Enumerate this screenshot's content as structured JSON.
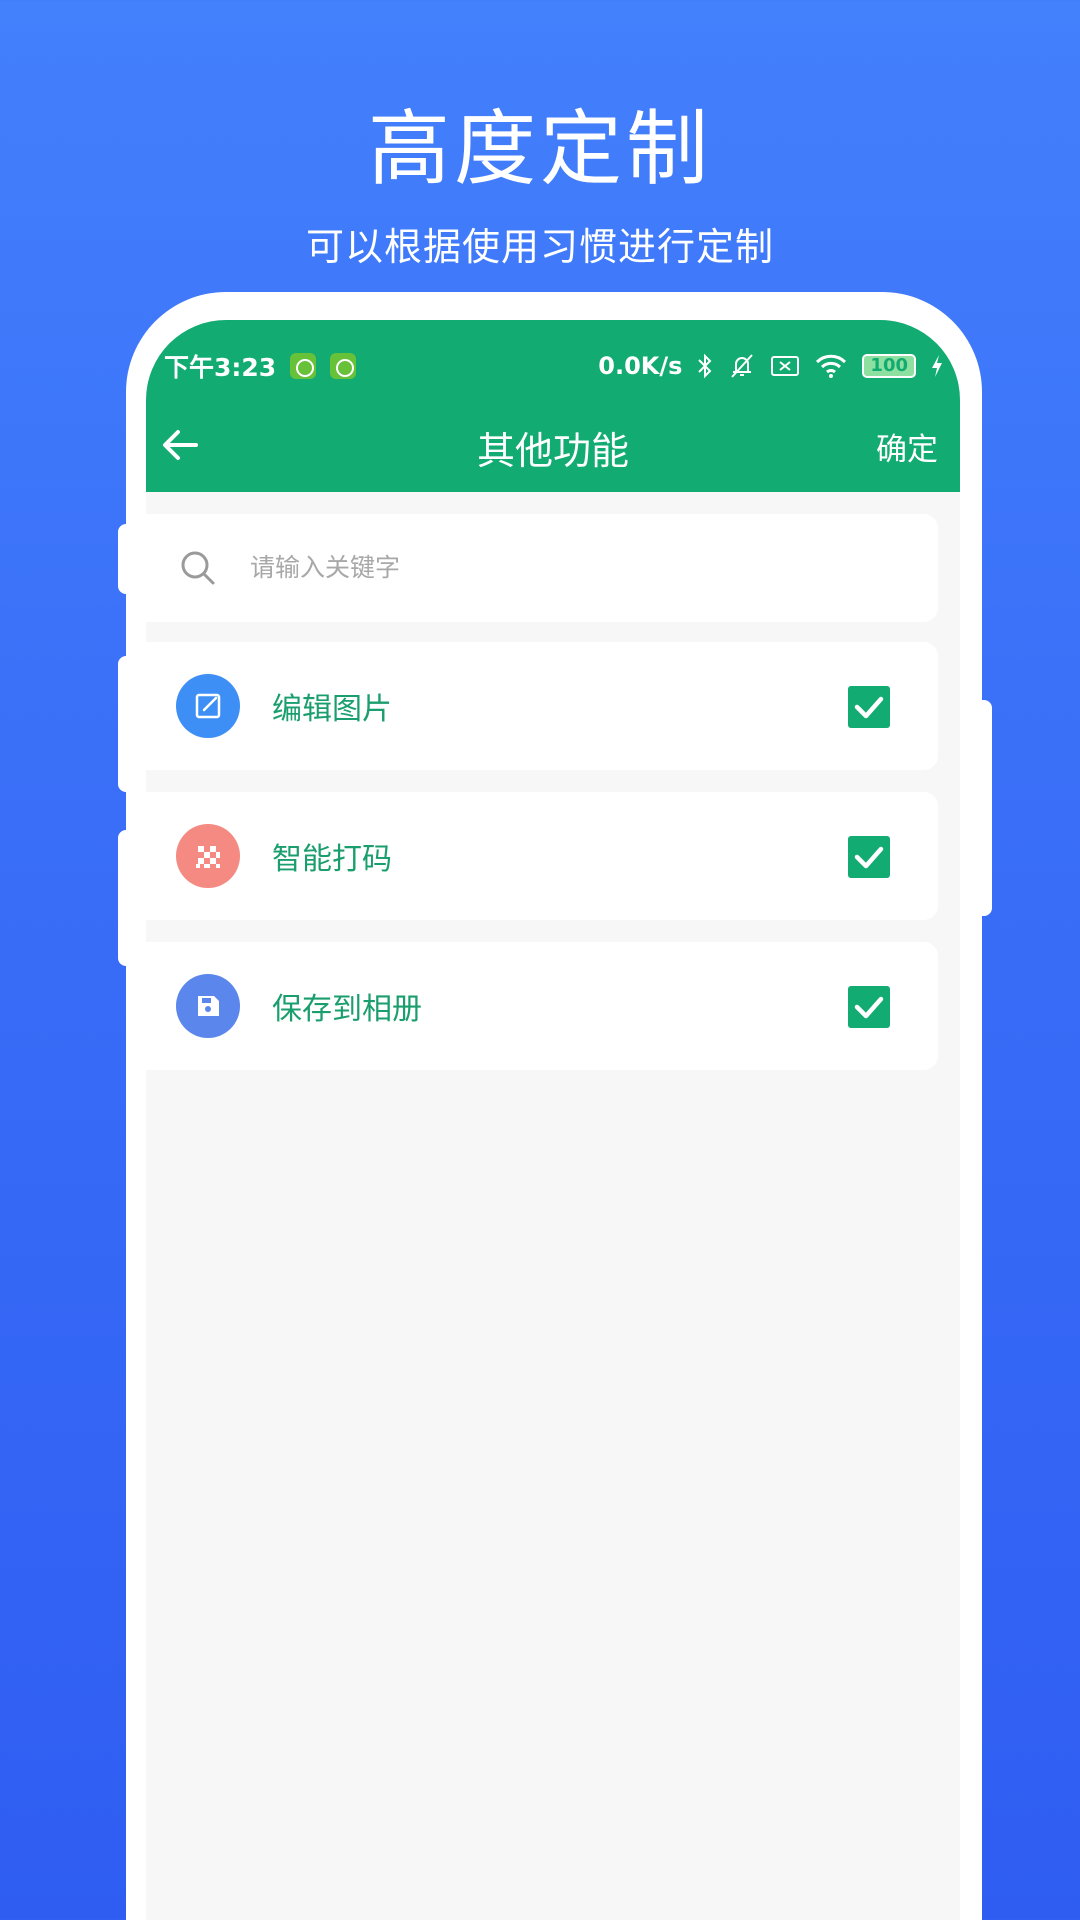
{
  "headline": "高度定制",
  "subline": "可以根据使用习惯进行定制",
  "status_bar": {
    "time": "下午3:23",
    "network_speed": "0.0K/s",
    "battery": "100",
    "icons": [
      "app-badge-icon",
      "app-badge-icon",
      "bluetooth-icon",
      "mute-bell-icon",
      "sim-off-icon",
      "wifi-icon",
      "battery-icon",
      "charging-icon"
    ]
  },
  "appbar": {
    "back_icon": "arrow-left-icon",
    "title": "其他功能",
    "confirm_label": "确定"
  },
  "search": {
    "icon": "search-icon",
    "placeholder": "请输入关键字"
  },
  "items": [
    {
      "label": "编辑图片",
      "icon": "edit-icon",
      "icon_color": "#3d8ff5",
      "checked": true
    },
    {
      "label": "智能打码",
      "icon": "mosaic-icon",
      "icon_color": "#f58a82",
      "checked": true
    },
    {
      "label": "保存到相册",
      "icon": "save-icon",
      "icon_color": "#5b86ec",
      "checked": true
    }
  ],
  "colors": {
    "accent": "#12ab72",
    "background_top": "#4380fc",
    "background_bottom": "#2f5df2"
  }
}
